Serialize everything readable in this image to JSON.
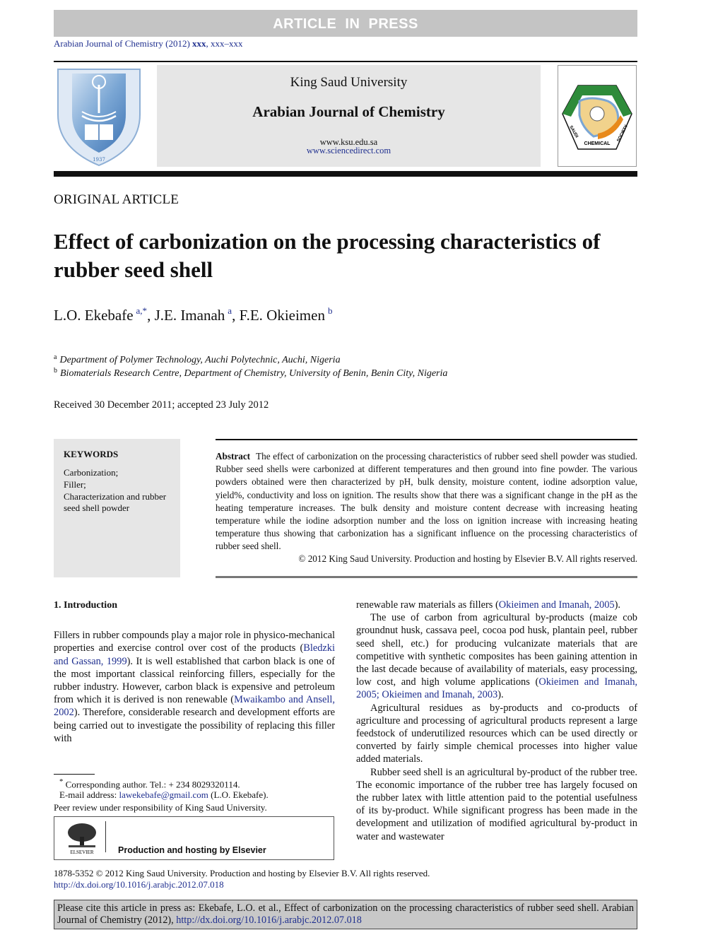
{
  "banner": {
    "text": "ARTICLE IN PRESS"
  },
  "journal_ref": {
    "prefix": "Arabian Journal of Chemistry (2012) ",
    "volume": "xxx",
    "pages": ", xxx–xxx"
  },
  "masthead": {
    "publisher": "King Saud University",
    "journal_name": "Arabian Journal of Chemistry",
    "ksu_url": "www.ksu.edu.sa",
    "sciencedirect_url": "www.sciencedirect.com",
    "left_logo": {
      "icon": "king-saud-university-crest-icon",
      "year": "1937"
    },
    "right_logo": {
      "icon": "saudi-chemical-society-logo-icon",
      "words": [
        "SAUDI",
        "CHEMICAL",
        "SOCIETY"
      ]
    }
  },
  "article": {
    "type": "ORIGINAL ARTICLE",
    "title": "Effect of carbonization on the processing characteristics of rubber seed shell",
    "authors": [
      {
        "name": "L.O. Ekebafe",
        "sup": "a,*"
      },
      {
        "name": "J.E. Imanah",
        "sup": "a"
      },
      {
        "name": "F.E. Okieimen",
        "sup": "b"
      }
    ],
    "affiliations": [
      {
        "label": "a",
        "text": "Department of Polymer Technology, Auchi Polytechnic, Auchi, Nigeria"
      },
      {
        "label": "b",
        "text": "Biomaterials Research Centre, Department of Chemistry, University of Benin, Benin City, Nigeria"
      }
    ],
    "received": "Received 30 December 2011; accepted 23 July 2012"
  },
  "keywords": {
    "title": "KEYWORDS",
    "items": [
      "Carbonization;",
      "Filler;",
      "Characterization and rubber seed shell powder"
    ]
  },
  "abstract": {
    "label": "Abstract",
    "text": "The effect of carbonization on the processing characteristics of rubber seed shell powder was studied. Rubber seed shells were carbonized at different temperatures and then ground into fine powder. The various powders obtained were then characterized by pH, bulk density, moisture content, iodine adsorption value, yield%, conductivity and loss on ignition. The results show that there was a significant change in the pH as the heating temperature increases. The bulk density and moisture content decrease with increasing heating temperature while the iodine adsorption number and the loss on ignition increase with increasing heating temperature thus showing that carbonization has a significant influence on the processing characteristics of rubber seed shell.",
    "copyright": "© 2012 King Saud University. Production and hosting by Elsevier B.V. All rights reserved."
  },
  "introduction": {
    "heading": "1. Introduction",
    "left_paragraph": {
      "t1": "Fillers in rubber compounds play a major role in physico-mechanical properties and exercise control over cost of the products (",
      "ref1": "Bledzki and Gassan, 1999",
      "t2": "). It is well established that carbon black is one of the most important classical reinforcing fillers, especially for the rubber industry. However, carbon black is expensive and petroleum from which it is derived is non renewable (",
      "ref2": "Mwaikambo and Ansell, 2002",
      "t3": "). Therefore, considerable research and development efforts are being carried out to investigate the possibility of replacing this filler with"
    },
    "right_p1": {
      "t1": "renewable raw materials as fillers (",
      "ref1": "Okieimen and Imanah, 2005",
      "t2": ")."
    },
    "right_p2": {
      "t1": "The use of carbon from agricultural by-products (maize cob groundnut husk, cassava peel, cocoa pod husk, plantain peel, rubber seed shell, etc.) for producing vulcanizate materials that are competitive with synthetic composites has been gaining attention in the last decade because of availability of materials, easy processing, low cost, and high volume applications (",
      "ref1": "Okieimen and Imanah, 2005; Okieimen and Imanah, 2003",
      "t2": ")."
    },
    "right_p3": "Agricultural residues as by-products and co-products of agriculture and processing of agricultural products represent a large feedstock of underutilized resources which can be used directly or converted by fairly simple chemical processes into higher value added materials.",
    "right_p4": "Rubber seed shell is an agricultural by-product of the rubber tree. The economic importance of the rubber tree has largely focused on the rubber latex with little attention paid to the potential usefulness of its by-product. While significant progress has been made in the development and utilization of modified agricultural by-product in water and wastewater"
  },
  "footnotes": {
    "corresponding": "Corresponding author. Tel.: + 234 8029320114.",
    "email_label": "E-mail address: ",
    "email": "lawekebafe@gmail.com",
    "email_suffix": " (L.O. Ekebafe).",
    "peer_review": "Peer review under responsibility of King Saud University.",
    "elsevier_logo_word": "ELSEVIER",
    "elsevier_text": "Production and hosting by Elsevier"
  },
  "footer": {
    "issn_line": "1878-5352 © 2012 King Saud University. Production and hosting by Elsevier B.V. All rights reserved.",
    "doi": "http://dx.doi.org/10.1016/j.arabjc.2012.07.018",
    "cite_text": "Please cite this article in press as: Ekebafe, L.O. et al., Effect of carbonization on the processing characteristics of rubber seed shell. Arabian Journal of Chemistry (2012), ",
    "cite_doi": "http://dx.doi.org/10.1016/j.arabjc.2012.07.018"
  },
  "colors": {
    "link": "#1f2f8f",
    "banner": "#c4c4c4",
    "panel": "#e6e6e6",
    "cite_box": "#c8c8c8"
  }
}
